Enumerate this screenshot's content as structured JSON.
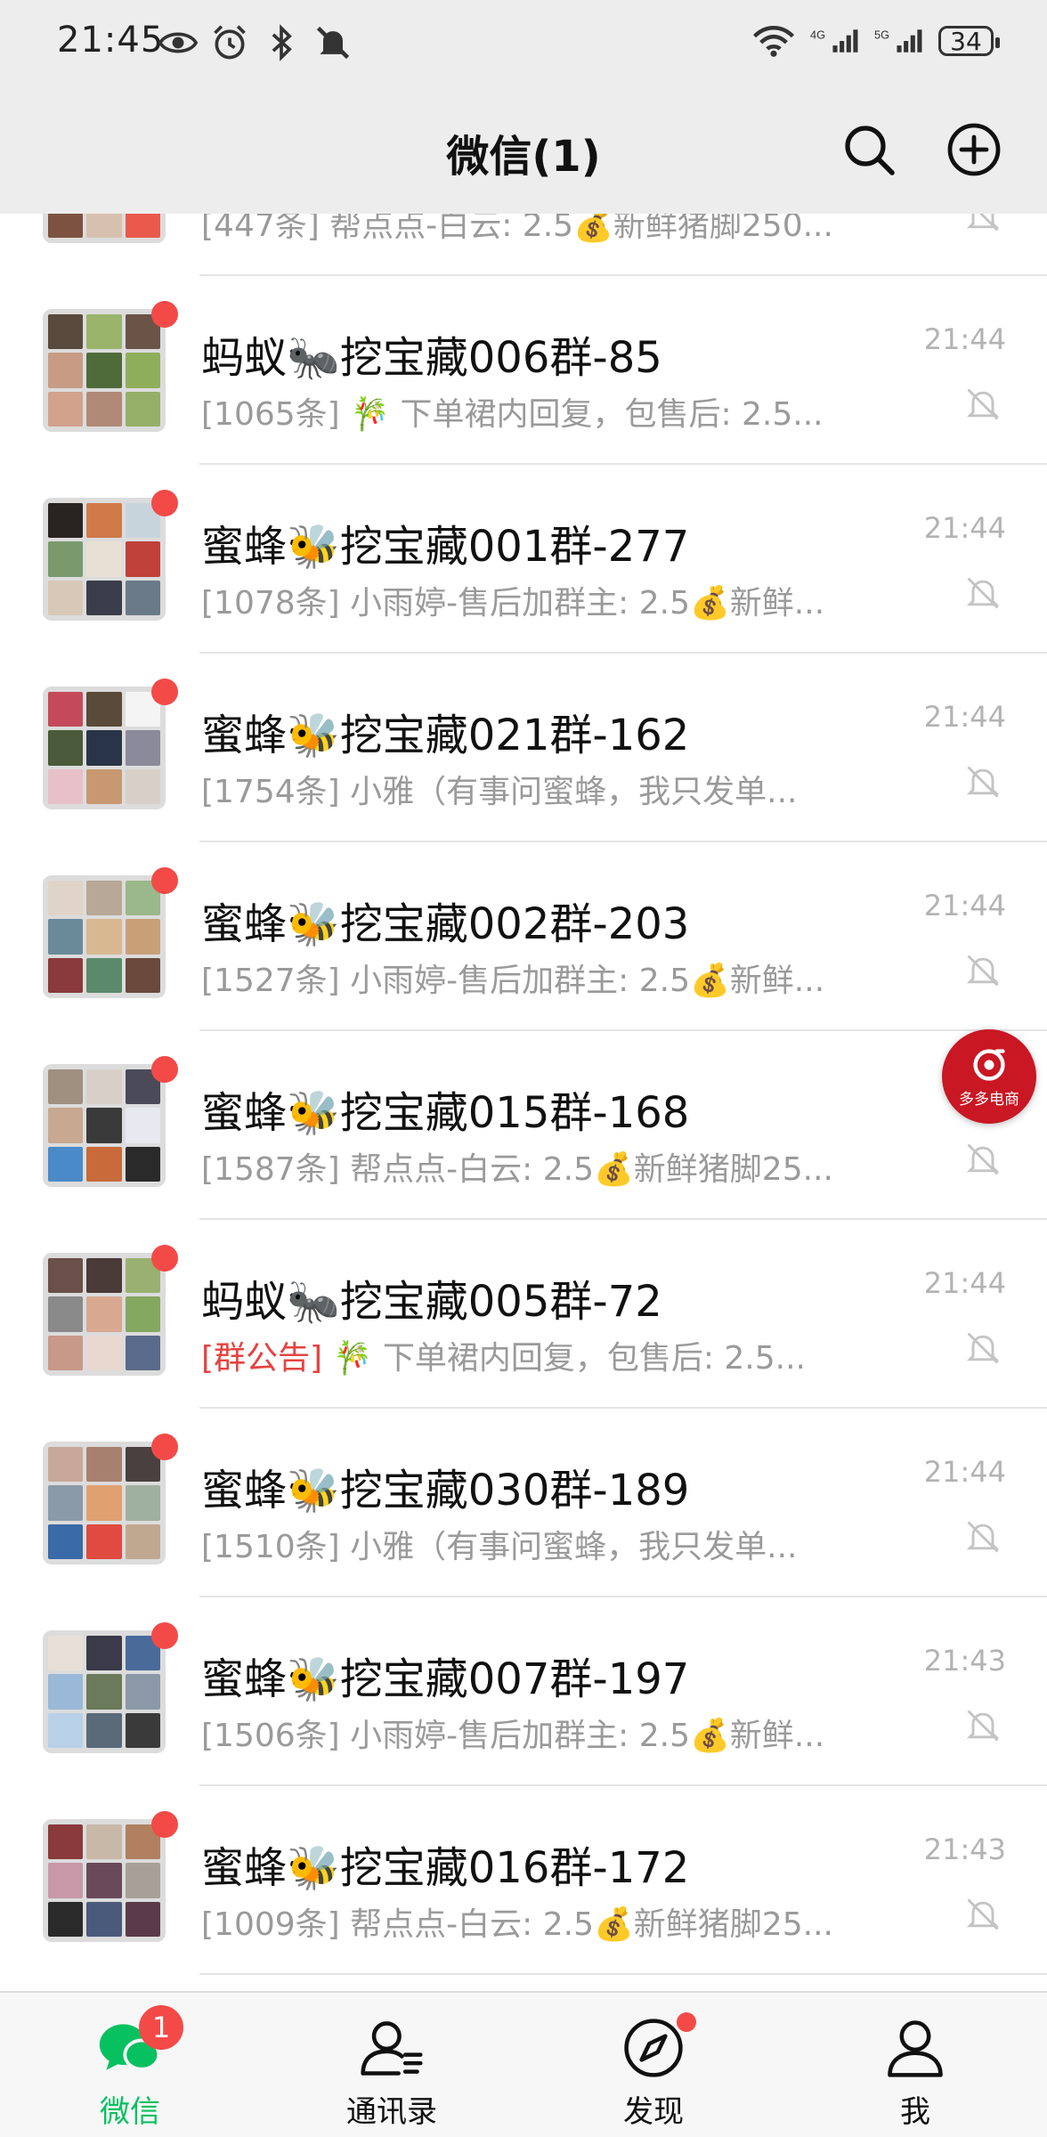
{
  "status_bar": {
    "time": "21:45",
    "network_4g": "4G",
    "network_5g": "5G",
    "battery": "34"
  },
  "header": {
    "title": "微信(1)"
  },
  "chats": [
    {
      "name": "",
      "preview_prefix": "[447条] 帮点点-白云: 2.5💰新鲜猪脚250...",
      "preview": "",
      "time": "",
      "unread": false
    },
    {
      "name": "蚂蚁🐜挖宝藏006群-85",
      "preview_prefix": "[1065条]",
      "preview": "🎋 下单裙内回复，包售后: 2.5...",
      "time": "21:44",
      "unread": true
    },
    {
      "name": "蜜蜂🐝挖宝藏001群-277",
      "preview_prefix": "[1078条]",
      "preview": "小雨婷-售后加群主: 2.5💰新鲜...",
      "time": "21:44",
      "unread": true
    },
    {
      "name": "蜜蜂🐝挖宝藏021群-162",
      "preview_prefix": "[1754条]",
      "preview": "小雅（有事问蜜蜂，我只发单...",
      "time": "21:44",
      "unread": true
    },
    {
      "name": "蜜蜂🐝挖宝藏002群-203",
      "preview_prefix": "[1527条]",
      "preview": "小雨婷-售后加群主: 2.5💰新鲜...",
      "time": "21:44",
      "unread": true
    },
    {
      "name": "蜜蜂🐝挖宝藏015群-168",
      "preview_prefix": "[1587条]",
      "preview": "帮点点-白云: 2.5💰新鲜猪脚25...",
      "time": "21:44",
      "unread": true
    },
    {
      "name": "蚂蚁🐜挖宝藏005群-72",
      "preview_prefix": "[群公告]",
      "preview": "🎋 下单裙内回复，包售后: 2.5...",
      "time": "21:44",
      "unread": true,
      "tag": true
    },
    {
      "name": "蜜蜂🐝挖宝藏030群-189",
      "preview_prefix": "[1510条]",
      "preview": "小雅（有事问蜜蜂，我只发单...",
      "time": "21:44",
      "unread": true
    },
    {
      "name": "蜜蜂🐝挖宝藏007群-197",
      "preview_prefix": "[1506条]",
      "preview": "小雨婷-售后加群主: 2.5💰新鲜...",
      "time": "21:43",
      "unread": true
    },
    {
      "name": "蜜蜂🐝挖宝藏016群-172",
      "preview_prefix": "[1009条]",
      "preview": "帮点点-白云: 2.5💰新鲜猪脚25...",
      "time": "21:43",
      "unread": true
    }
  ],
  "float_ad": {
    "label": "多多电商"
  },
  "tabbar": {
    "tabs": [
      {
        "label": "微信",
        "badge": "1",
        "icon": "chat-bubble-icon",
        "active": true
      },
      {
        "label": "通讯录",
        "icon": "contacts-icon"
      },
      {
        "label": "发现",
        "icon": "compass-icon",
        "dot": true
      },
      {
        "label": "我",
        "icon": "person-icon"
      }
    ]
  },
  "colors": {
    "accent": "#07c160",
    "badge": "#f34a48",
    "header_bg": "#ededed"
  }
}
